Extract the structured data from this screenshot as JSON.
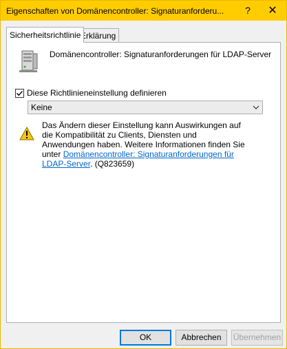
{
  "window": {
    "title": "Eigenschaften von Domänencontroller: Signaturanforderu...",
    "help_glyph": "?",
    "close_glyph": "✕"
  },
  "tabs": [
    {
      "label": "Sicherheitsrichtlinie",
      "active": true
    },
    {
      "label": "Erklärung",
      "active": false
    }
  ],
  "policy": {
    "icon": "server-icon",
    "name": "Domänencontroller: Signaturanforderungen für LDAP-Server"
  },
  "define_setting": {
    "checked": true,
    "label": "Diese Richtlinieneinstellung definieren"
  },
  "dropdown": {
    "selected": "Keine"
  },
  "warning": {
    "icon": "warning-icon",
    "text_before_link": "Das Ändern dieser Einstellung kann Auswirkungen auf die Kompatibilität zu Clients, Diensten und Anwendungen haben. Weitere Informationen finden Sie unter ",
    "link_text": "Domänencontroller: Signaturanforderungen für LDAP-Server",
    "text_after_link": ". (Q823659)"
  },
  "buttons": {
    "ok": "OK",
    "cancel": "Abbrechen",
    "apply": "Übernehmen"
  },
  "colors": {
    "titlebar": "#ffcc00",
    "link": "#0066cc",
    "focus_border": "#0078d7"
  }
}
